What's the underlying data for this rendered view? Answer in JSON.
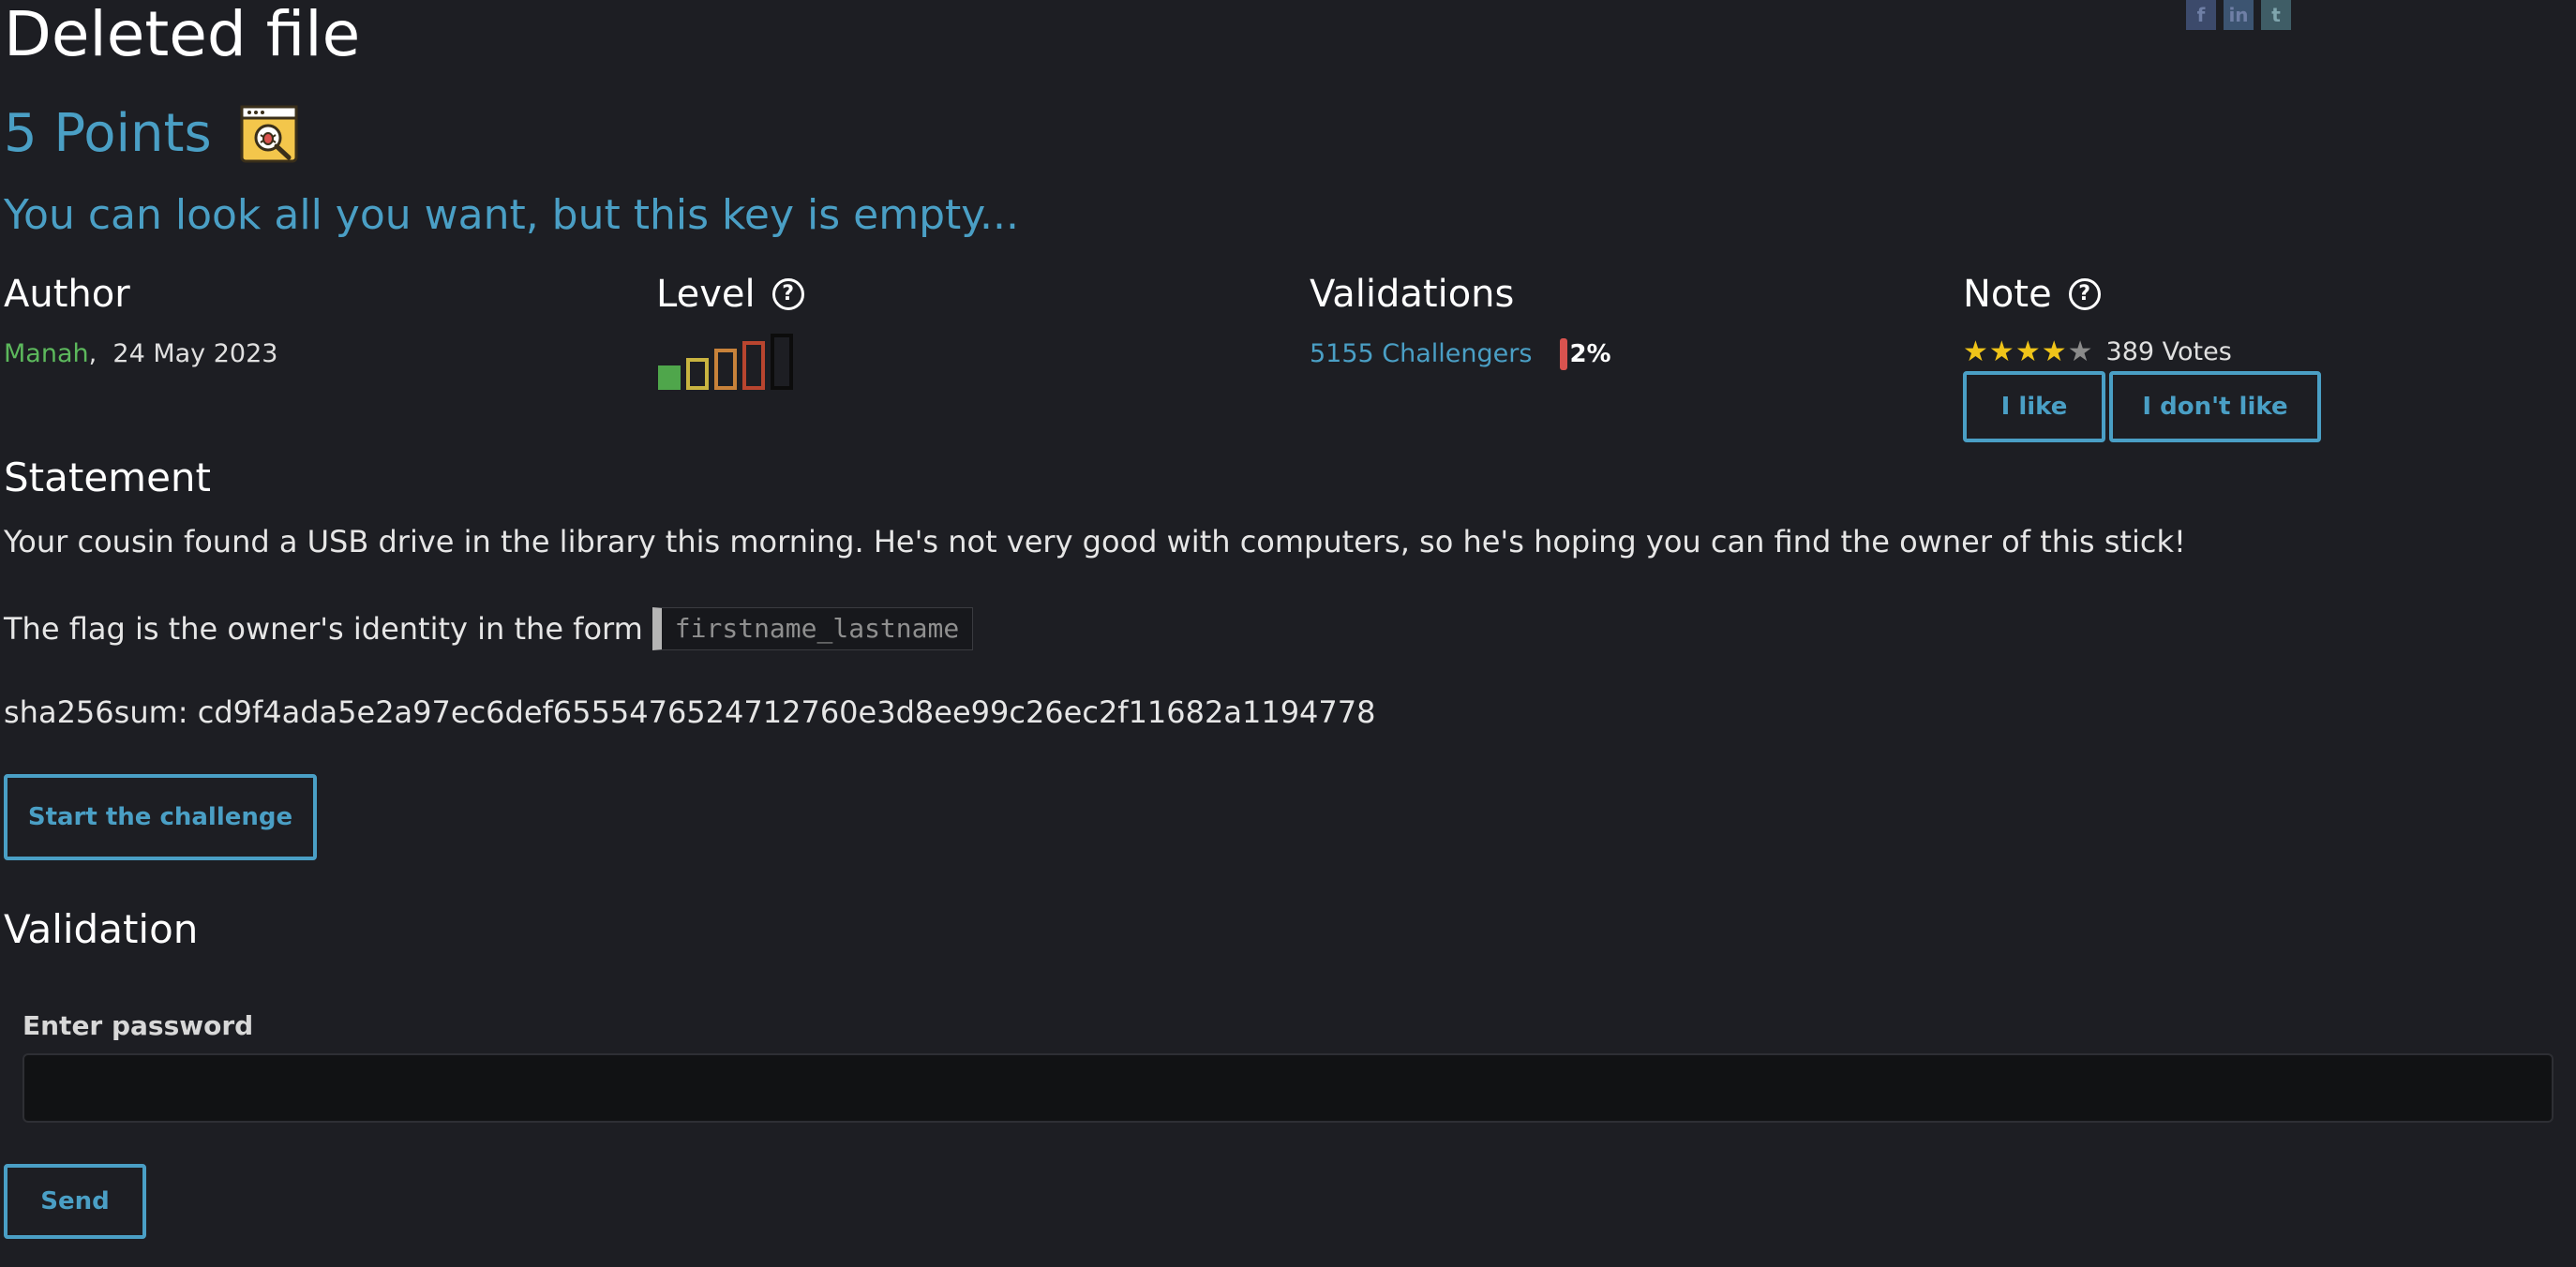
{
  "challenge": {
    "title": "Deleted file",
    "points": "5 Points",
    "subtitle": "You can look all you want, but this key is empty..."
  },
  "share": {
    "icons": [
      "facebook-icon",
      "linkedin-icon",
      "twitter-icon"
    ],
    "facebook": "f",
    "linkedin": "in",
    "twitter": "t"
  },
  "author": {
    "heading": "Author",
    "name": "Manah",
    "separator": ",",
    "date": "24 May 2023"
  },
  "level": {
    "heading": "Level",
    "filled": 1,
    "total": 5,
    "colors": [
      "#4fa64b",
      "#c9b440",
      "#c8823a",
      "#b9452f",
      "#0c0c0c"
    ]
  },
  "validations": {
    "heading": "Validations",
    "challengers": "5155 Challengers",
    "percent": "2%"
  },
  "note": {
    "heading": "Note",
    "stars_filled": 4,
    "stars_total": 5,
    "votes": "389 Votes",
    "like_label": "I like",
    "dislike_label": "I don't like"
  },
  "statement": {
    "heading": "Statement",
    "para1": "Your cousin found a USB drive in the library this morning. He's not very good with computers, so he's hoping you can find the owner of this stick!",
    "para2_prefix": "The flag is the owner's identity in the form",
    "flag_format": "firstname_lastname",
    "para3": "sha256sum: cd9f4ada5e2a97ec6def6555476524712760e3d8ee99c26ec2f11682a1194778",
    "start_label": "Start the challenge"
  },
  "validation": {
    "heading": "Validation",
    "password_label": "Enter password",
    "password_value": "",
    "send_label": "Send"
  },
  "colors": {
    "background": "#1d1e23",
    "accent": "#4a9fc5",
    "author": "#5cb85c",
    "star": "#f0c419",
    "percent_bar": "#d9534f"
  }
}
